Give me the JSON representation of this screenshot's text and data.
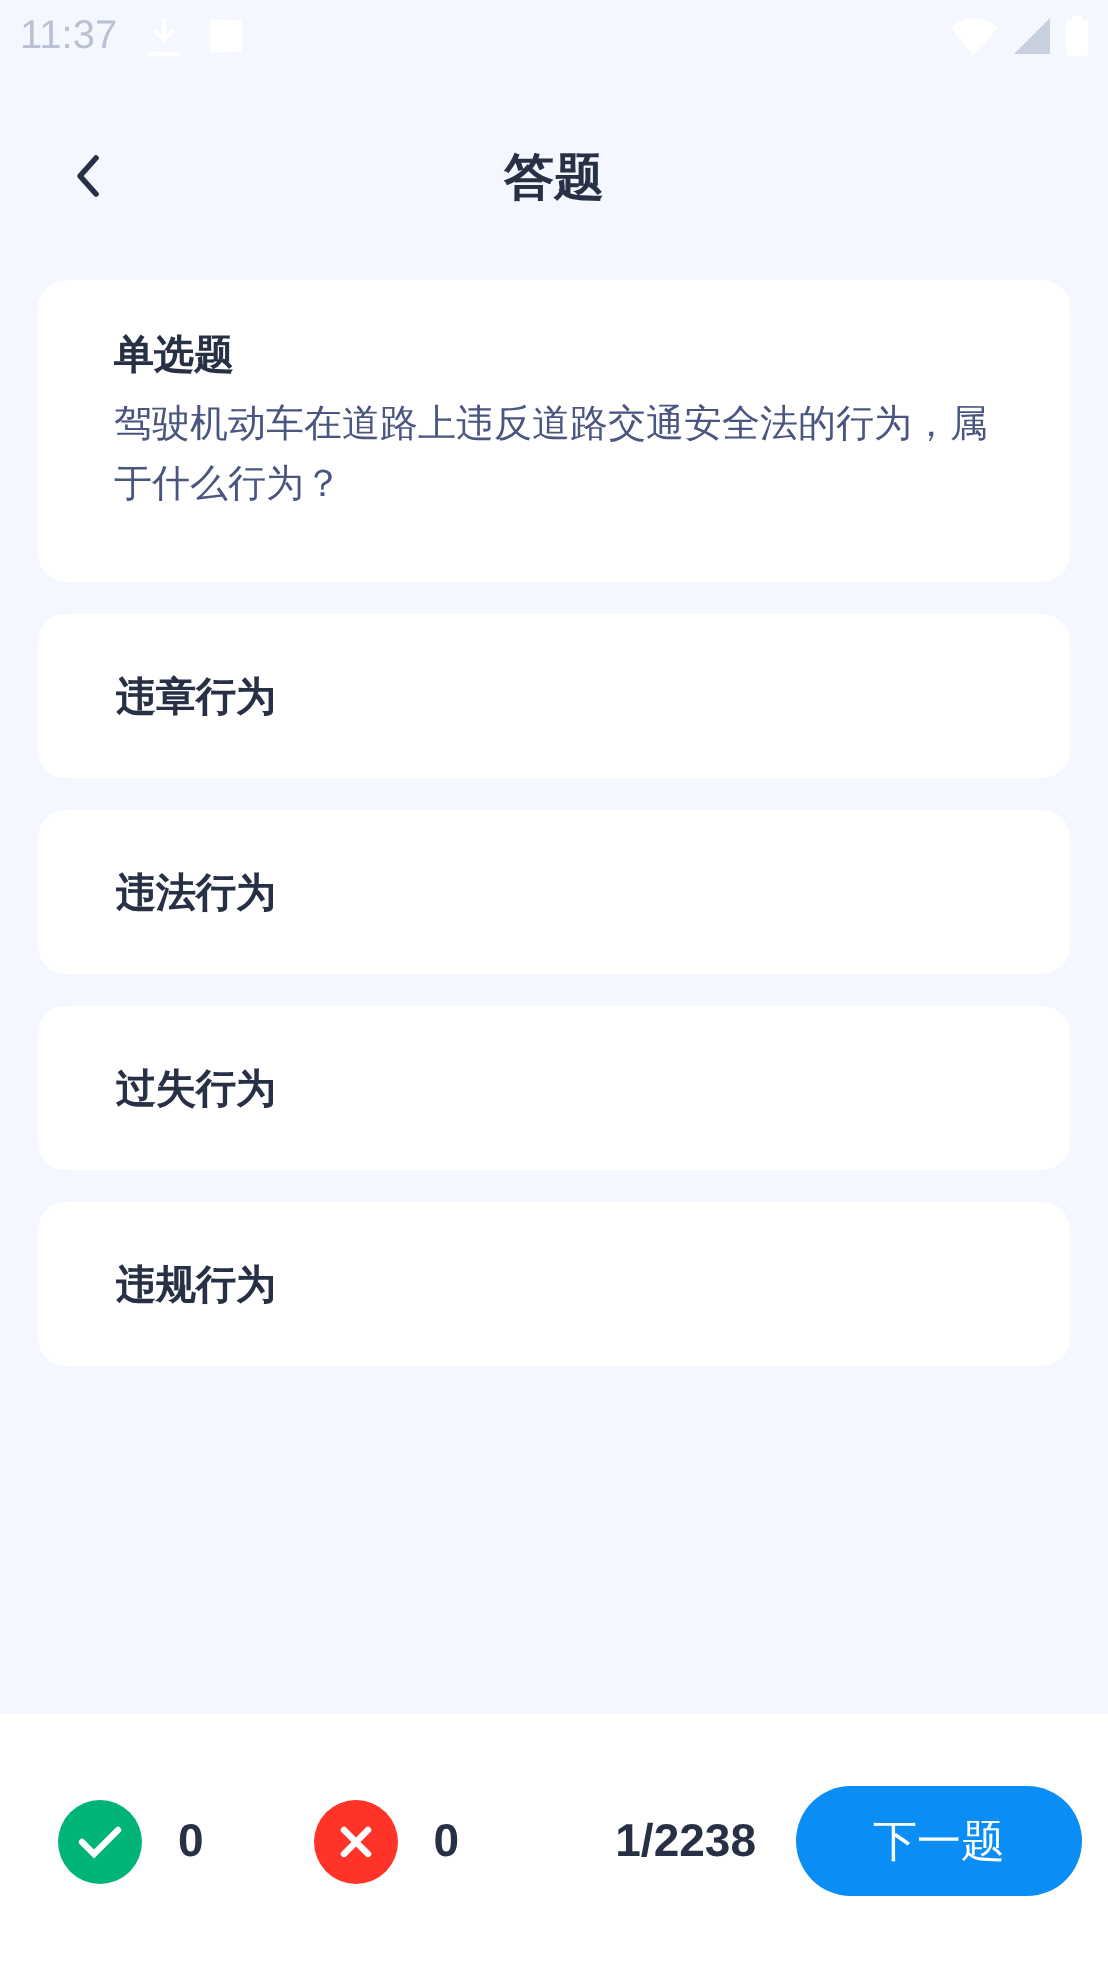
{
  "status_bar": {
    "time": "11:37"
  },
  "header": {
    "title": "答题"
  },
  "question": {
    "type": "单选题",
    "text": "驾驶机动车在道路上违反道路交通安全法的行为，属于什么行为？"
  },
  "options": [
    {
      "label": "违章行为",
      "selected": false
    },
    {
      "label": "违法行为",
      "selected": false
    },
    {
      "label": "过失行为",
      "selected": false
    },
    {
      "label": "违规行为",
      "selected": false
    }
  ],
  "footer": {
    "correct": "0",
    "wrong": "0",
    "progress": "1/2238",
    "next": "下一题"
  }
}
